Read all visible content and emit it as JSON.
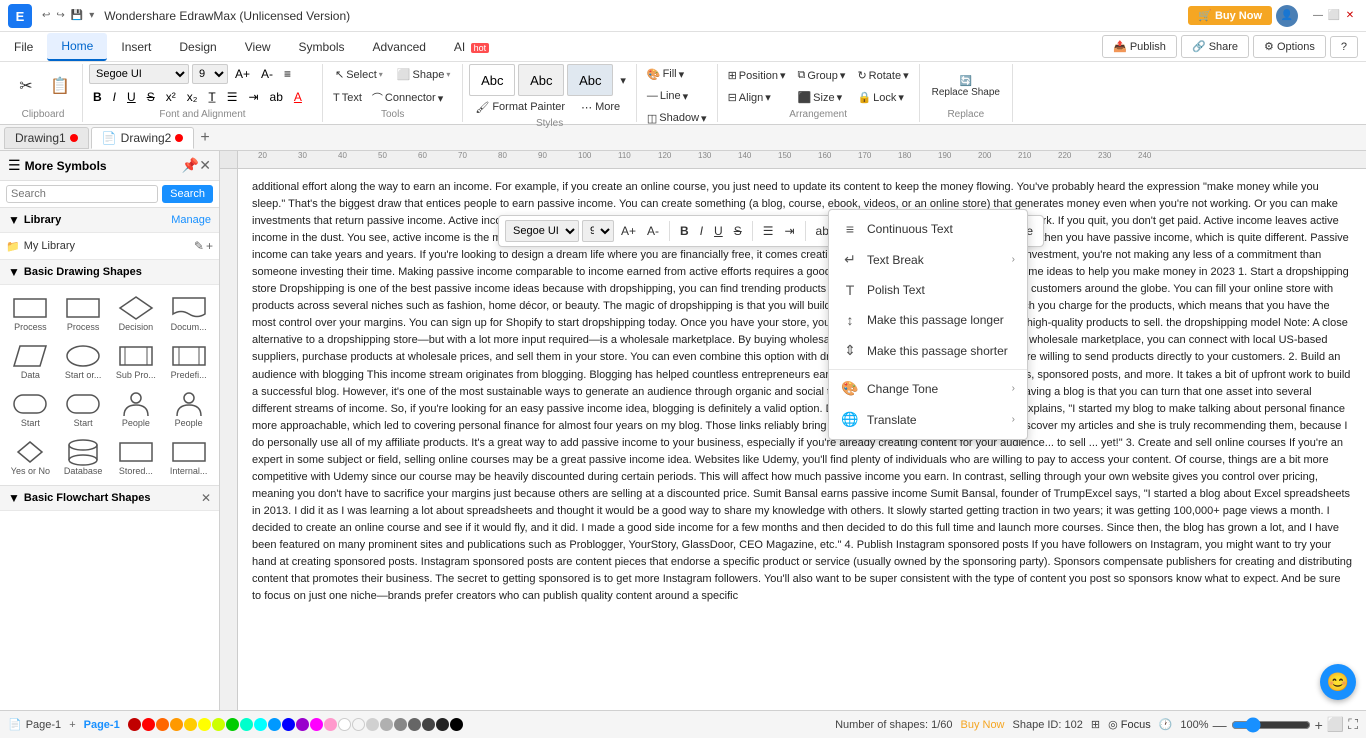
{
  "app": {
    "title": "Wondershare EdrawMax (Unlicensed Version)",
    "buy_now": "🛒 Buy Now"
  },
  "quick_access": [
    "↩",
    "↪",
    "⬜",
    "⬇",
    "⬛"
  ],
  "window_controls": [
    "—",
    "⬜",
    "✕"
  ],
  "menu": {
    "items": [
      "File",
      "Home",
      "Insert",
      "Design",
      "View",
      "Symbols",
      "Advanced"
    ],
    "ai_label": "AI",
    "ai_hot": "hot",
    "active": "Home",
    "right_actions": [
      "Publish",
      "Share",
      "Options",
      "?"
    ]
  },
  "ribbon": {
    "clipboard": {
      "label": "Clipboard",
      "buttons": [
        "✂",
        "📋"
      ]
    },
    "font_family": "Segoe UI",
    "font_size": "9",
    "bold": "B",
    "italic": "I",
    "underline": "U",
    "strikethrough": "S",
    "superscript": "x²",
    "subscript": "x₂",
    "font_color": "A",
    "font_group_label": "Font and Alignment",
    "tools_label": "Tools",
    "select_label": "Select",
    "shape_label": "Shape",
    "text_label": "Text",
    "connector_label": "Connector",
    "styles_label": "Styles",
    "fill_label": "Fill",
    "line_label": "Line",
    "shadow_label": "Shadow",
    "arrangement_label": "Arrangement",
    "position_label": "Position",
    "group_label": "Group",
    "rotate_label": "Rotate",
    "align_label": "Align",
    "size_label": "Size",
    "lock_label": "Lock",
    "replace_label": "Replace",
    "replace_shape_label": "Replace Shape",
    "format_painter_label": "Format\nPainter",
    "more_label": "More",
    "abc_labels": [
      "Abc",
      "Abc",
      "Abc"
    ]
  },
  "tabs": [
    {
      "label": "Drawing1",
      "dot": true,
      "active": false
    },
    {
      "label": "Drawing2",
      "dot": true,
      "active": true
    }
  ],
  "panel": {
    "title": "More Symbols",
    "search_placeholder": "Search",
    "search_btn": "Search",
    "library_label": "Library",
    "manage_label": "Manage",
    "my_library_label": "My Library",
    "basic_shapes_label": "Basic Drawing Shapes",
    "flowchart_label": "Basic Flowchart Shapes"
  },
  "shapes": {
    "basic": [
      {
        "label": "Process",
        "shape": "rect"
      },
      {
        "label": "Process",
        "shape": "rect"
      },
      {
        "label": "Decision",
        "shape": "diamond"
      },
      {
        "label": "Docum...",
        "shape": "doc"
      },
      {
        "label": "Data",
        "shape": "parallelogram"
      },
      {
        "label": "Start or...",
        "shape": "oval"
      },
      {
        "label": "Sub Pro...",
        "shape": "subrect"
      },
      {
        "label": "Predefi...",
        "shape": "predef"
      },
      {
        "label": "Start",
        "shape": "round"
      },
      {
        "label": "Start",
        "shape": "round2"
      },
      {
        "label": "People",
        "shape": "person"
      },
      {
        "label": "People",
        "shape": "person2"
      },
      {
        "label": "Yes or No",
        "shape": "hexagon"
      },
      {
        "label": "Database",
        "shape": "cylinder"
      },
      {
        "label": "Stored...",
        "shape": "rect2"
      },
      {
        "label": "Internal...",
        "shape": "internal"
      }
    ]
  },
  "float_toolbar": {
    "font": "Segoe UI",
    "size": "9",
    "bold": "B",
    "italic": "I",
    "underline": "U",
    "strikethrough": "S",
    "align": "≡",
    "size_up": "A+",
    "size_down": "A-",
    "color": "A"
  },
  "context_menu": {
    "items": [
      {
        "icon": "≡",
        "label": "Continuous Text",
        "has_arrow": false
      },
      {
        "icon": "↵",
        "label": "Text Break",
        "has_arrow": true
      },
      {
        "icon": "T",
        "label": "Polish Text",
        "has_arrow": false
      },
      {
        "icon": "📏",
        "label": "Make this passage longer",
        "has_arrow": false
      },
      {
        "icon": "📐",
        "label": "Make this passage shorter",
        "has_arrow": false
      },
      {
        "icon": "🎨",
        "label": "Change Tone",
        "has_arrow": true
      },
      {
        "icon": "🌐",
        "label": "Translate",
        "has_arrow": true
      }
    ]
  },
  "canvas_text": "additional effort along the way to earn an income. For example, if you create an online course, you just need to update its content to keep the money flowing. You've probably heard the expression \"make money while you sleep.\" That's the biggest draw that entices people to earn passive income. You can create something (a blog, course, ebook, videos, or an online store) that generates money even when you're not working. Or you can make investments that return passive income. Active income vs. passive Income: Which is best for me? In the end, active income is the money generated from active work. If you quit, you don't get paid. Active income leaves active income in the dust. You see, active income is the money generated from active work. If you quit, you don't get paid. Active income time literally equals money. And then you have passive income, which is quite different. Passive income can take years and years. If you're looking to design a dream life where you are financially free, it comes creating a steady income stream with a small investment, you're not making any less of a commitment than someone investing their time. Making passive income comparable to income earned from active efforts requires a good amount of work upfront. 23 passive income ideas to help you make money in 2023 1. Start a dropshipping store Dropshipping is one of the best passive income ideas because with dropshipping, you can find trending products on marketplaces like AliExpress to sell to customers around the globe. You can fill your online store with products across several niches such as fashion, home décor, or beauty. The magic of dropshipping is that you will build your own business and decide how much you charge for the products, which means that you have the most control over your margins. You can sign up for Shopify to start dropshipping today. Once you have your store, you'll need to use dropshipping apps to find high-quality products to sell. the dropshipping model Note: A close alternative to a dropshipping store—but with a lot more input required—is a wholesale marketplace. By buying wholesale products to sell on your store. Using a wholesale marketplace, you can connect with local US-based suppliers, purchase products at wholesale prices, and sell them in your store. You can even combine this option with dropshipping by finding wholesalers who are willing to send products directly to your customers. 2. Build an audience with blogging This income stream originates from blogging. Blogging has helped countless entrepreneurs earn passively through affiliate links, courses, sponsored posts, and more. It takes a bit of upfront work to build a successful blog. However, it's one of the most sustainable ways to generate an audience through organic and social traffic to your blog. The best part about having a blog is that you can turn that one asset into several different streams of income. So, if you're looking for an easy passive income idea, blogging is definitely a valid option. Desirae Odjick, founder of Half Banked, explains, \"I started my blog to make talking about personal finance more approachable, which led to covering personal finance for almost four years on my blog. Those links reliably bring in four figures every month, as people discover my articles and she is truly recommending them, because I do personally use all of my affiliate products. It's a great way to add passive income to your business, especially if you're already creating content for your audience... to sell ... yet!\" 3. Create and sell online courses If you're an expert in some subject or field, selling online courses may be a great passive income idea. Websites like Udemy, you'll find plenty of individuals who are willing to pay to access your content. Of course, things are a bit more competitive with Udemy since our course may be heavily discounted during certain periods. This will affect how much passive income you earn. In contrast, selling through your own website gives you control over pricing, meaning you don't have to sacrifice your margins just because others are selling at a discounted price. Sumit Bansal earns passive income Sumit Bansal, founder of TrumpExcel says, \"I started a blog about Excel spreadsheets in 2013. I did it as I was learning a lot about spreadsheets and thought it would be a good way to share my knowledge with others. It slowly started getting traction in two years; it was getting 100,000+ page views a month. I decided to create an online course and see if it would fly, and it did. I made a good side income for a few months and then decided to do this full time and launch more courses. Since then, the blog has grown a lot, and I have been featured on many prominent sites and publications such as Problogger, YourStory, GlassDoor, CEO Magazine, etc.\" 4. Publish Instagram sponsored posts If you have followers on Instagram, you might want to try your hand at creating sponsored posts. Instagram sponsored posts are content pieces that endorse a specific product or service (usually owned by the sponsoring party). Sponsors compensate publishers for creating and distributing content that promotes their business. The secret to getting sponsored is to get more Instagram followers. You'll also want to be super consistent with the type of content you post so sponsors know what to expect. And be sure to focus on just one niche—brands prefer creators who can publish quality content around a specific",
  "status": {
    "page_label": "Page-1",
    "page_current": "Page-1",
    "shapes_count": "Number of shapes: 1/60",
    "buy_now": "Buy Now",
    "shape_id": "Shape ID: 102",
    "focus_label": "Focus",
    "zoom_pct": "100%"
  },
  "colors": [
    "#c00000",
    "#ff0000",
    "#ff4500",
    "#ff8c00",
    "#ffd700",
    "#ffff00",
    "#adff2f",
    "#00ff00",
    "#00fa9a",
    "#00ffff",
    "#00bfff",
    "#0000ff",
    "#8a2be2",
    "#ff00ff",
    "#ff69b4",
    "#ffffff",
    "#f5f5f5",
    "#dcdcdc",
    "#c0c0c0",
    "#a9a9a9",
    "#808080",
    "#696969",
    "#333333",
    "#000000"
  ]
}
